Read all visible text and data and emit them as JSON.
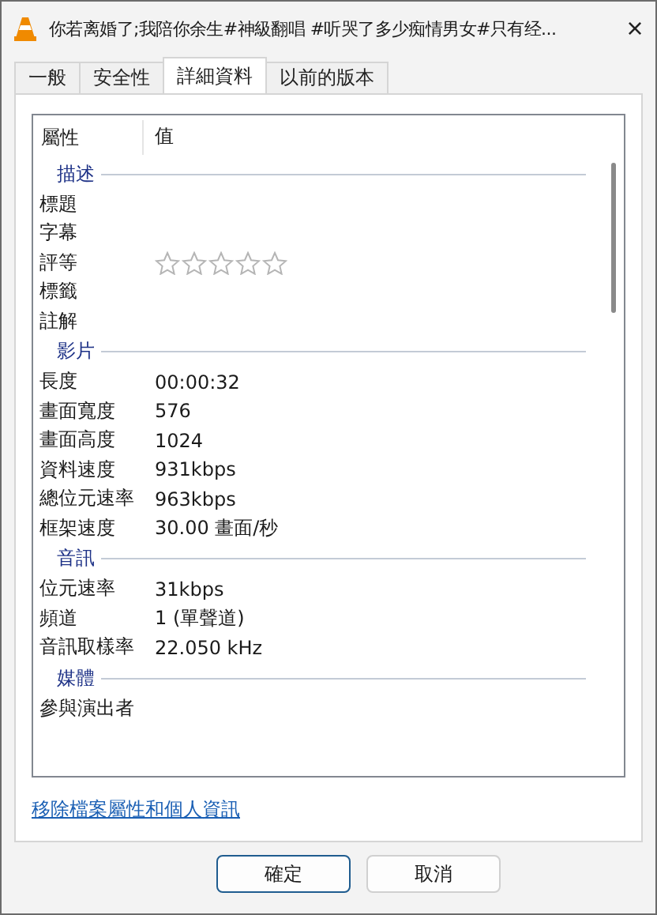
{
  "window": {
    "title": "你若离婚了;我陪你余生#神級翻唱 #听哭了多少痴情男女#只有经...",
    "close": "×"
  },
  "tabs": [
    {
      "label": "一般",
      "selected": false
    },
    {
      "label": "安全性",
      "selected": false
    },
    {
      "label": "詳細資料",
      "selected": true
    },
    {
      "label": "以前的版本",
      "selected": false
    }
  ],
  "properties": {
    "columns": [
      "屬性",
      "值"
    ],
    "groups": [
      {
        "name": "描述",
        "rows": [
          {
            "kind": "text",
            "label": "標題"
          },
          {
            "kind": "text",
            "label": "字幕"
          },
          {
            "kind": "rating",
            "label": "評等",
            "stars": 0
          },
          {
            "kind": "text",
            "label": "標籤"
          },
          {
            "kind": "text",
            "label": "註解"
          }
        ]
      },
      {
        "name": "影片",
        "rows": [
          {
            "kind": "text",
            "label": "長度",
            "value": "00:00:32"
          },
          {
            "kind": "text",
            "label": "畫面寬度",
            "value": "576"
          },
          {
            "kind": "text",
            "label": "畫面高度",
            "value": "1024"
          },
          {
            "kind": "text",
            "label": "資料速度",
            "value": "931kbps"
          },
          {
            "kind": "text",
            "label": "總位元速率",
            "value": "963kbps"
          },
          {
            "kind": "text",
            "label": "框架速度",
            "value": "30.00 畫面/秒"
          }
        ]
      },
      {
        "name": "音訊",
        "rows": [
          {
            "kind": "text",
            "label": "位元速率",
            "value": "31kbps"
          },
          {
            "kind": "text",
            "label": "頻道",
            "value": "1 (單聲道)"
          },
          {
            "kind": "text",
            "label": "音訊取樣率",
            "value": "22.050 kHz"
          }
        ]
      },
      {
        "name": "媒體",
        "rows": [
          {
            "kind": "text",
            "label": "參與演出者"
          }
        ]
      }
    ]
  },
  "link": "移除檔案屬性和個人資訊",
  "buttons": [
    {
      "label": "確定",
      "default": true
    },
    {
      "label": "取消",
      "default": false
    }
  ]
}
